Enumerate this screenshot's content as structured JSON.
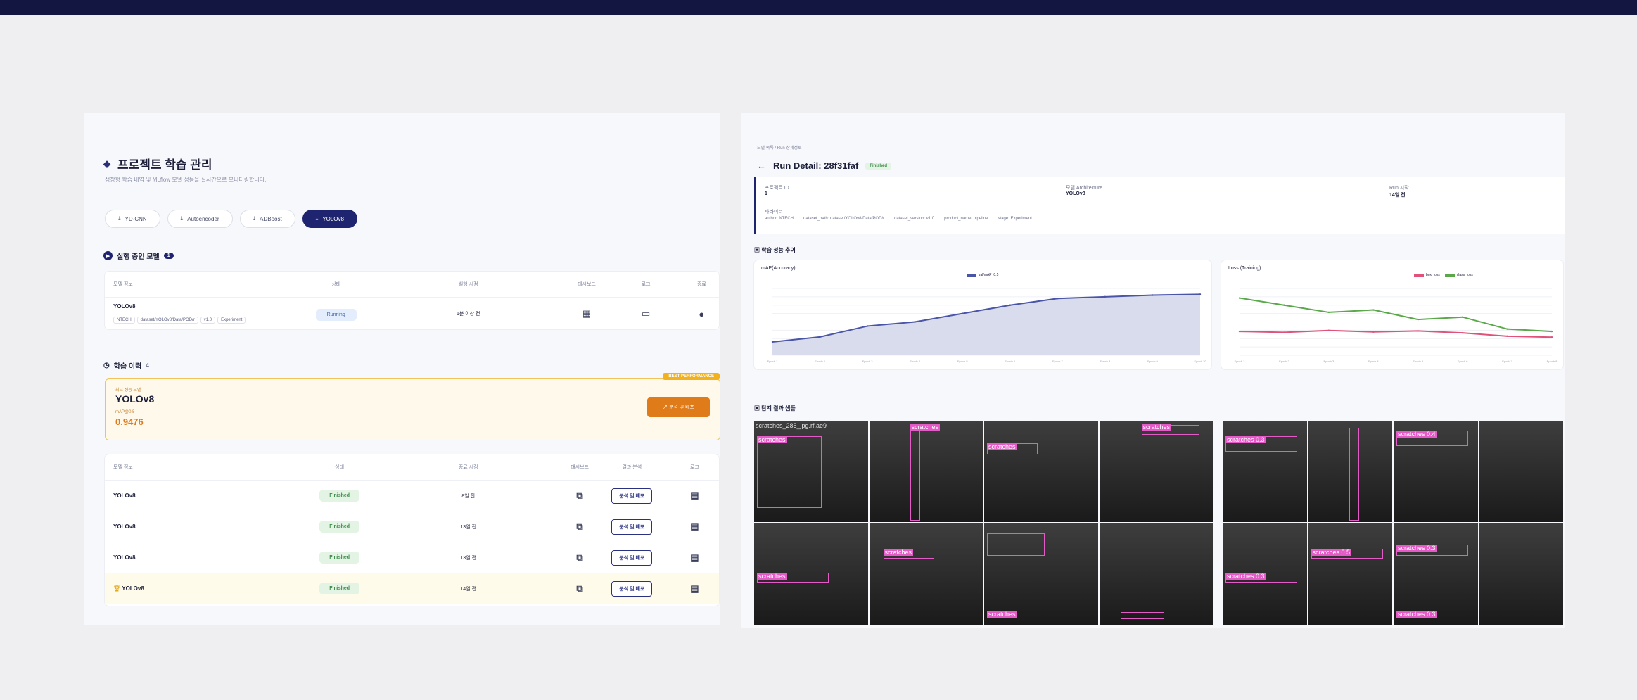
{
  "left": {
    "title": "프로젝트 학습 관리",
    "subtitle": "성장형 학습 내역 및 MLflow 모델 성능을 실시간으로 모니터링합니다.",
    "tabs": [
      "YD-CNN",
      "Autoencoder",
      "ADBoost",
      "YOLOv8"
    ],
    "active_section": {
      "title": "실행 중인 모델",
      "count": "1",
      "headers": [
        "모델 정보",
        "상태",
        "실행 시점",
        "대시보드",
        "로그",
        "종료"
      ],
      "row": {
        "name": "YOLOv8",
        "tags": [
          "NTECH",
          "dataset/YOLOv8/Data/POD/r",
          "v1.0",
          "Experiment"
        ],
        "status": "Running",
        "time": "1분 이상 전"
      }
    },
    "history": {
      "title": "학습 이력",
      "count": "4",
      "best": {
        "label": "최고 성능 모델",
        "name": "YOLOv8",
        "metric_label": "mAP@0.5",
        "metric_value": "0.9476",
        "badge": "BEST PERFORMANCE",
        "button": "분석 및 배포"
      },
      "headers": [
        "모델 정보",
        "상태",
        "종료 시점",
        "대시보드",
        "결과 분석",
        "로그"
      ],
      "rows": [
        {
          "name": "YOLOv8",
          "status": "Finished",
          "time": "8일 전",
          "button": "분석 및 배포"
        },
        {
          "name": "YOLOv8",
          "status": "Finished",
          "time": "13일 전",
          "button": "분석 및 배포"
        },
        {
          "name": "YOLOv8",
          "status": "Finished",
          "time": "13일 전",
          "button": "분석 및 배포"
        },
        {
          "name": "YOLOv8",
          "status": "Finished",
          "time": "14일 전",
          "button": "분석 및 배포"
        }
      ]
    }
  },
  "right": {
    "breadcrumb": [
      "모델 목록",
      "Run 상세정보"
    ],
    "title": "Run Detail: 28f31faf",
    "status": "Finished",
    "info": {
      "k1": "프로젝트 ID",
      "v1": "1",
      "k2": "모델 Architecture",
      "v2": "YOLOv8",
      "k3": "Run 시작",
      "v3": "14일 전",
      "params_label": "파라미터",
      "params": [
        "author: NTECH",
        "dataset_path: dataset/YOLOv8/Data/POD/r",
        "dataset_version: v1.0",
        "product_name: pipeline",
        "stage: Experiment"
      ]
    },
    "perf_title": "학습 성능 추이",
    "charts_title": "탐지 결과 샘플",
    "map_chart": {
      "title": "mAP(Accuracy)",
      "legend": "val/mAP_0.5"
    },
    "loss_chart": {
      "title": "Loss (Training)",
      "legend": [
        "box_loss",
        "class_loss"
      ]
    }
  },
  "chart_data": [
    {
      "type": "area",
      "title": "mAP(Accuracy)",
      "x": [
        "Epoch 1",
        "Epoch 2",
        "Epoch 3",
        "Epoch 4",
        "Epoch 5",
        "Epoch 6",
        "Epoch 7",
        "Epoch 8",
        "Epoch 9",
        "Epoch 10"
      ],
      "series": [
        {
          "name": "val/mAP_0.5",
          "values": [
            0.36,
            0.42,
            0.55,
            0.6,
            0.7,
            0.8,
            0.88,
            0.9,
            0.92,
            0.93
          ]
        }
      ]
    },
    {
      "type": "line",
      "title": "Loss (Training)",
      "x": [
        "Epoch 1",
        "Epoch 2",
        "Epoch 3",
        "Epoch 4",
        "Epoch 5",
        "Epoch 6",
        "Epoch 7",
        "Epoch 8"
      ],
      "series": [
        {
          "name": "box_loss",
          "values": [
            0.8,
            0.78,
            0.82,
            0.79,
            0.81,
            0.77,
            0.7,
            0.68
          ]
        },
        {
          "name": "class_loss",
          "values": [
            1.5,
            1.35,
            1.2,
            1.25,
            1.05,
            1.1,
            0.85,
            0.8
          ]
        }
      ]
    }
  ],
  "det_labels": [
    "scratches",
    "scratches 0.4",
    "scratches 0.3",
    "scratches 0.5",
    "scratches_285_jpg.rf.ae9"
  ]
}
